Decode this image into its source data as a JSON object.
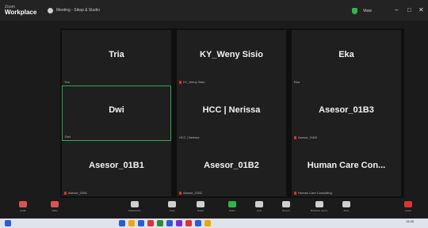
{
  "app": {
    "brand_line1": "Zoom",
    "brand_line2": "Workplace",
    "meeting_title": "Meeting - Sikap & Studio"
  },
  "header": {
    "view_label": "View"
  },
  "window_controls": [
    "–",
    "□",
    "✕"
  ],
  "participants": [
    {
      "name": "Tria",
      "tag": "Tria",
      "muted": false,
      "active": false
    },
    {
      "name": "KY_Weny Sisio",
      "tag": "KY_Weny Sisio",
      "muted": true,
      "active": false
    },
    {
      "name": "Eka",
      "tag": "Eka",
      "muted": false,
      "active": false
    },
    {
      "name": "Dwi",
      "tag": "Dwi",
      "muted": false,
      "active": true
    },
    {
      "name": "HCC | Nerissa",
      "tag": "HCC | Nerissa",
      "muted": false,
      "active": false
    },
    {
      "name": "Asesor_01B3",
      "tag": "Asesor_01B3",
      "muted": true,
      "active": false
    },
    {
      "name": "Asesor_01B1",
      "tag": "Asesor_01B1",
      "muted": true,
      "active": false
    },
    {
      "name": "Asesor_01B2",
      "tag": "Asesor_01B2",
      "muted": true,
      "active": false
    },
    {
      "name": "Human Care Con...",
      "tag": "Human Care Consulting",
      "muted": true,
      "active": false
    }
  ],
  "toolbar": {
    "items": [
      {
        "label": "Audio",
        "icon": "microphone-icon",
        "color": "#d9534f"
      },
      {
        "label": "Video",
        "icon": "camera-icon",
        "color": "#d9534f"
      },
      {
        "label": "Participants",
        "icon": "participants-icon",
        "color": "#cfcfcf"
      },
      {
        "label": "Chat",
        "icon": "chat-icon",
        "color": "#cfcfcf"
      },
      {
        "label": "React",
        "icon": "react-icon",
        "color": "#cfcfcf"
      },
      {
        "label": "Share",
        "icon": "share-icon",
        "color": "#35b34a"
      },
      {
        "label": "Host",
        "icon": "host-icon",
        "color": "#cfcfcf"
      },
      {
        "label": "Record",
        "icon": "record-icon",
        "color": "#cfcfcf"
      },
      {
        "label": "Breakout rooms",
        "icon": "apps-icon",
        "color": "#cfcfcf"
      },
      {
        "label": "More",
        "icon": "more-icon",
        "color": "#cfcfcf"
      },
      {
        "label": "Leave",
        "icon": "leave-icon",
        "color": "#d33"
      }
    ]
  },
  "taskbar": {
    "apps": [
      "#2b5bd7",
      "#f0a500",
      "#2b5bd7",
      "#d33",
      "#2b8a3e",
      "#2b5bd7",
      "#7a2bd7",
      "#d33",
      "#2b5bd7",
      "#f0a500"
    ],
    "time": "13:45",
    "date": "20/04/2024"
  }
}
